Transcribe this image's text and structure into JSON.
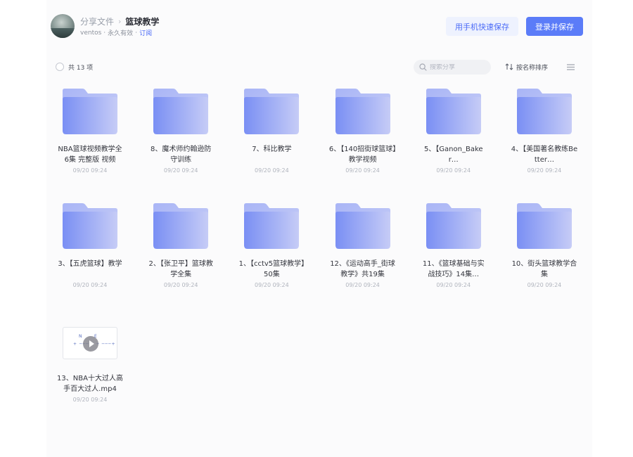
{
  "header": {
    "breadcrumb_root": "分享文件",
    "breadcrumb_sep": "›",
    "breadcrumb_current": "篮球教学",
    "owner": "ventos",
    "validity": "永久有效",
    "subscribe": "订阅",
    "mobile_save_label": "用手机快速保存",
    "login_save_label": "登录并保存"
  },
  "toolbar": {
    "count_label": "共 13 项",
    "search_placeholder": "搜索分享",
    "sort_label": "按名称排序"
  },
  "colors": {
    "accent": "#5b7cf8",
    "link": "#4b6bf7",
    "folder_light": "#c4cbf7",
    "folder_dark": "#7d93f5"
  },
  "files": [
    {
      "type": "folder",
      "name": "NBA篮球视频教学全6集 完整版 视频",
      "date": "09/20 09:24"
    },
    {
      "type": "folder",
      "name": "8、魔术师约翰逊防守训练",
      "date": "09/20 09:24"
    },
    {
      "type": "folder",
      "name": "7、科比教学",
      "date": "09/20 09:24"
    },
    {
      "type": "folder",
      "name": "6、【140招街球篮球】教学视频",
      "date": "09/20 09:24"
    },
    {
      "type": "folder",
      "name": "5、【Ganon_Baker…",
      "date": "09/20 09:24"
    },
    {
      "type": "folder",
      "name": "4、【美国著名教练Better…",
      "date": "09/20 09:24"
    },
    {
      "type": "folder",
      "name": "3、【五虎篮球】教学",
      "date": "09/20 09:24"
    },
    {
      "type": "folder",
      "name": "2、【张卫平】篮球教学全集",
      "date": "09/20 09:24"
    },
    {
      "type": "folder",
      "name": "1、【cctv5篮球教学】50集",
      "date": "09/20 09:24"
    },
    {
      "type": "folder",
      "name": "12、《运动高手_街球教学》共19集",
      "date": "09/20 09:24"
    },
    {
      "type": "folder",
      "name": "11、《篮球基础与实战技巧》14集…",
      "date": "09/20 09:24"
    },
    {
      "type": "folder",
      "name": "10、街头篮球教学合集",
      "date": "09/20 09:24"
    },
    {
      "type": "video",
      "name": "13、NBA十大过人高手百大过人.mp4",
      "date": "09/20 09:24",
      "icon": "video-thumbnail"
    }
  ]
}
